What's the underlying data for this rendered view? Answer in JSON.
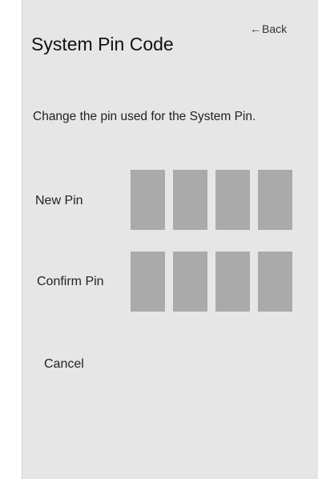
{
  "header": {
    "back_label": "Back",
    "title": "System Pin Code"
  },
  "description": "Change the pin used for the System Pin.",
  "new_pin": {
    "label": "New Pin",
    "digit_count": 4
  },
  "confirm_pin": {
    "label": "Confirm Pin",
    "digit_count": 4
  },
  "actions": {
    "cancel_label": "Cancel"
  },
  "colors": {
    "panel_background": "#e6e6e6",
    "pin_box": "#aaaaaa",
    "text": "#222222"
  },
  "icons": {
    "back": "left-arrow-icon"
  }
}
